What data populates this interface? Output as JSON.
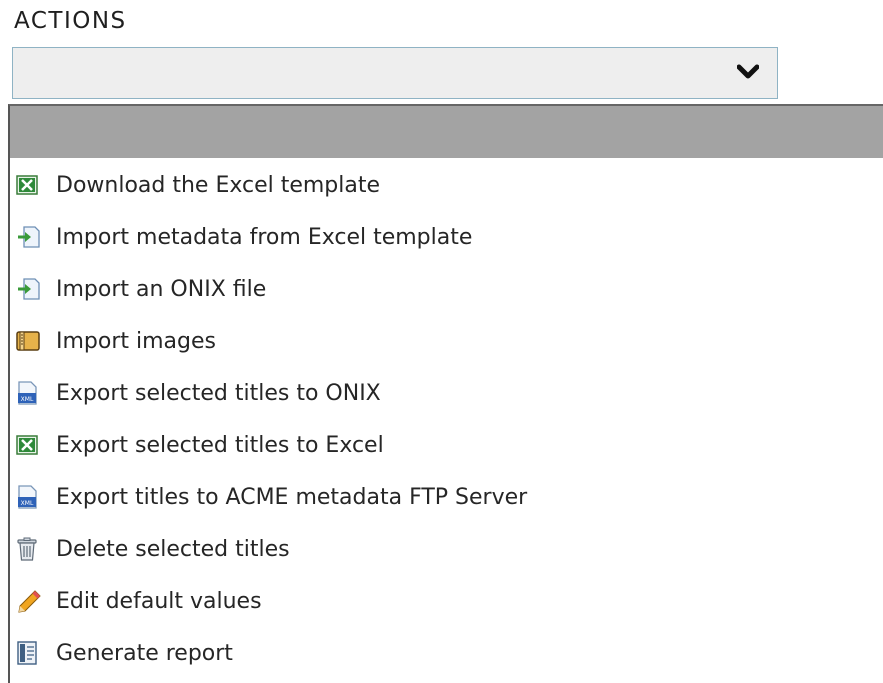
{
  "actions_label": "ACTIONS",
  "select": {
    "value": "",
    "chevron_icon": "chevron-down-icon"
  },
  "menu": {
    "items": [
      {
        "label": "Download the Excel template",
        "icon": "excel-icon"
      },
      {
        "label": "Import metadata from Excel template",
        "icon": "import-file-icon"
      },
      {
        "label": "Import an ONIX file",
        "icon": "import-file-icon"
      },
      {
        "label": "Import images",
        "icon": "archive-icon"
      },
      {
        "label": "Export selected titles to ONIX",
        "icon": "xml-file-icon"
      },
      {
        "label": "Export selected titles to Excel",
        "icon": "excel-icon"
      },
      {
        "label": "Export titles to ACME metadata FTP Server",
        "icon": "xml-file-icon"
      },
      {
        "label": "Delete selected titles",
        "icon": "trash-icon"
      },
      {
        "label": "Edit default values",
        "icon": "pencil-icon"
      },
      {
        "label": "Generate report",
        "icon": "report-icon"
      }
    ]
  },
  "colors": {
    "select_border": "#8fb3c4",
    "select_bg": "#eeeeee",
    "dropdown_header": "#a3a3a3"
  }
}
